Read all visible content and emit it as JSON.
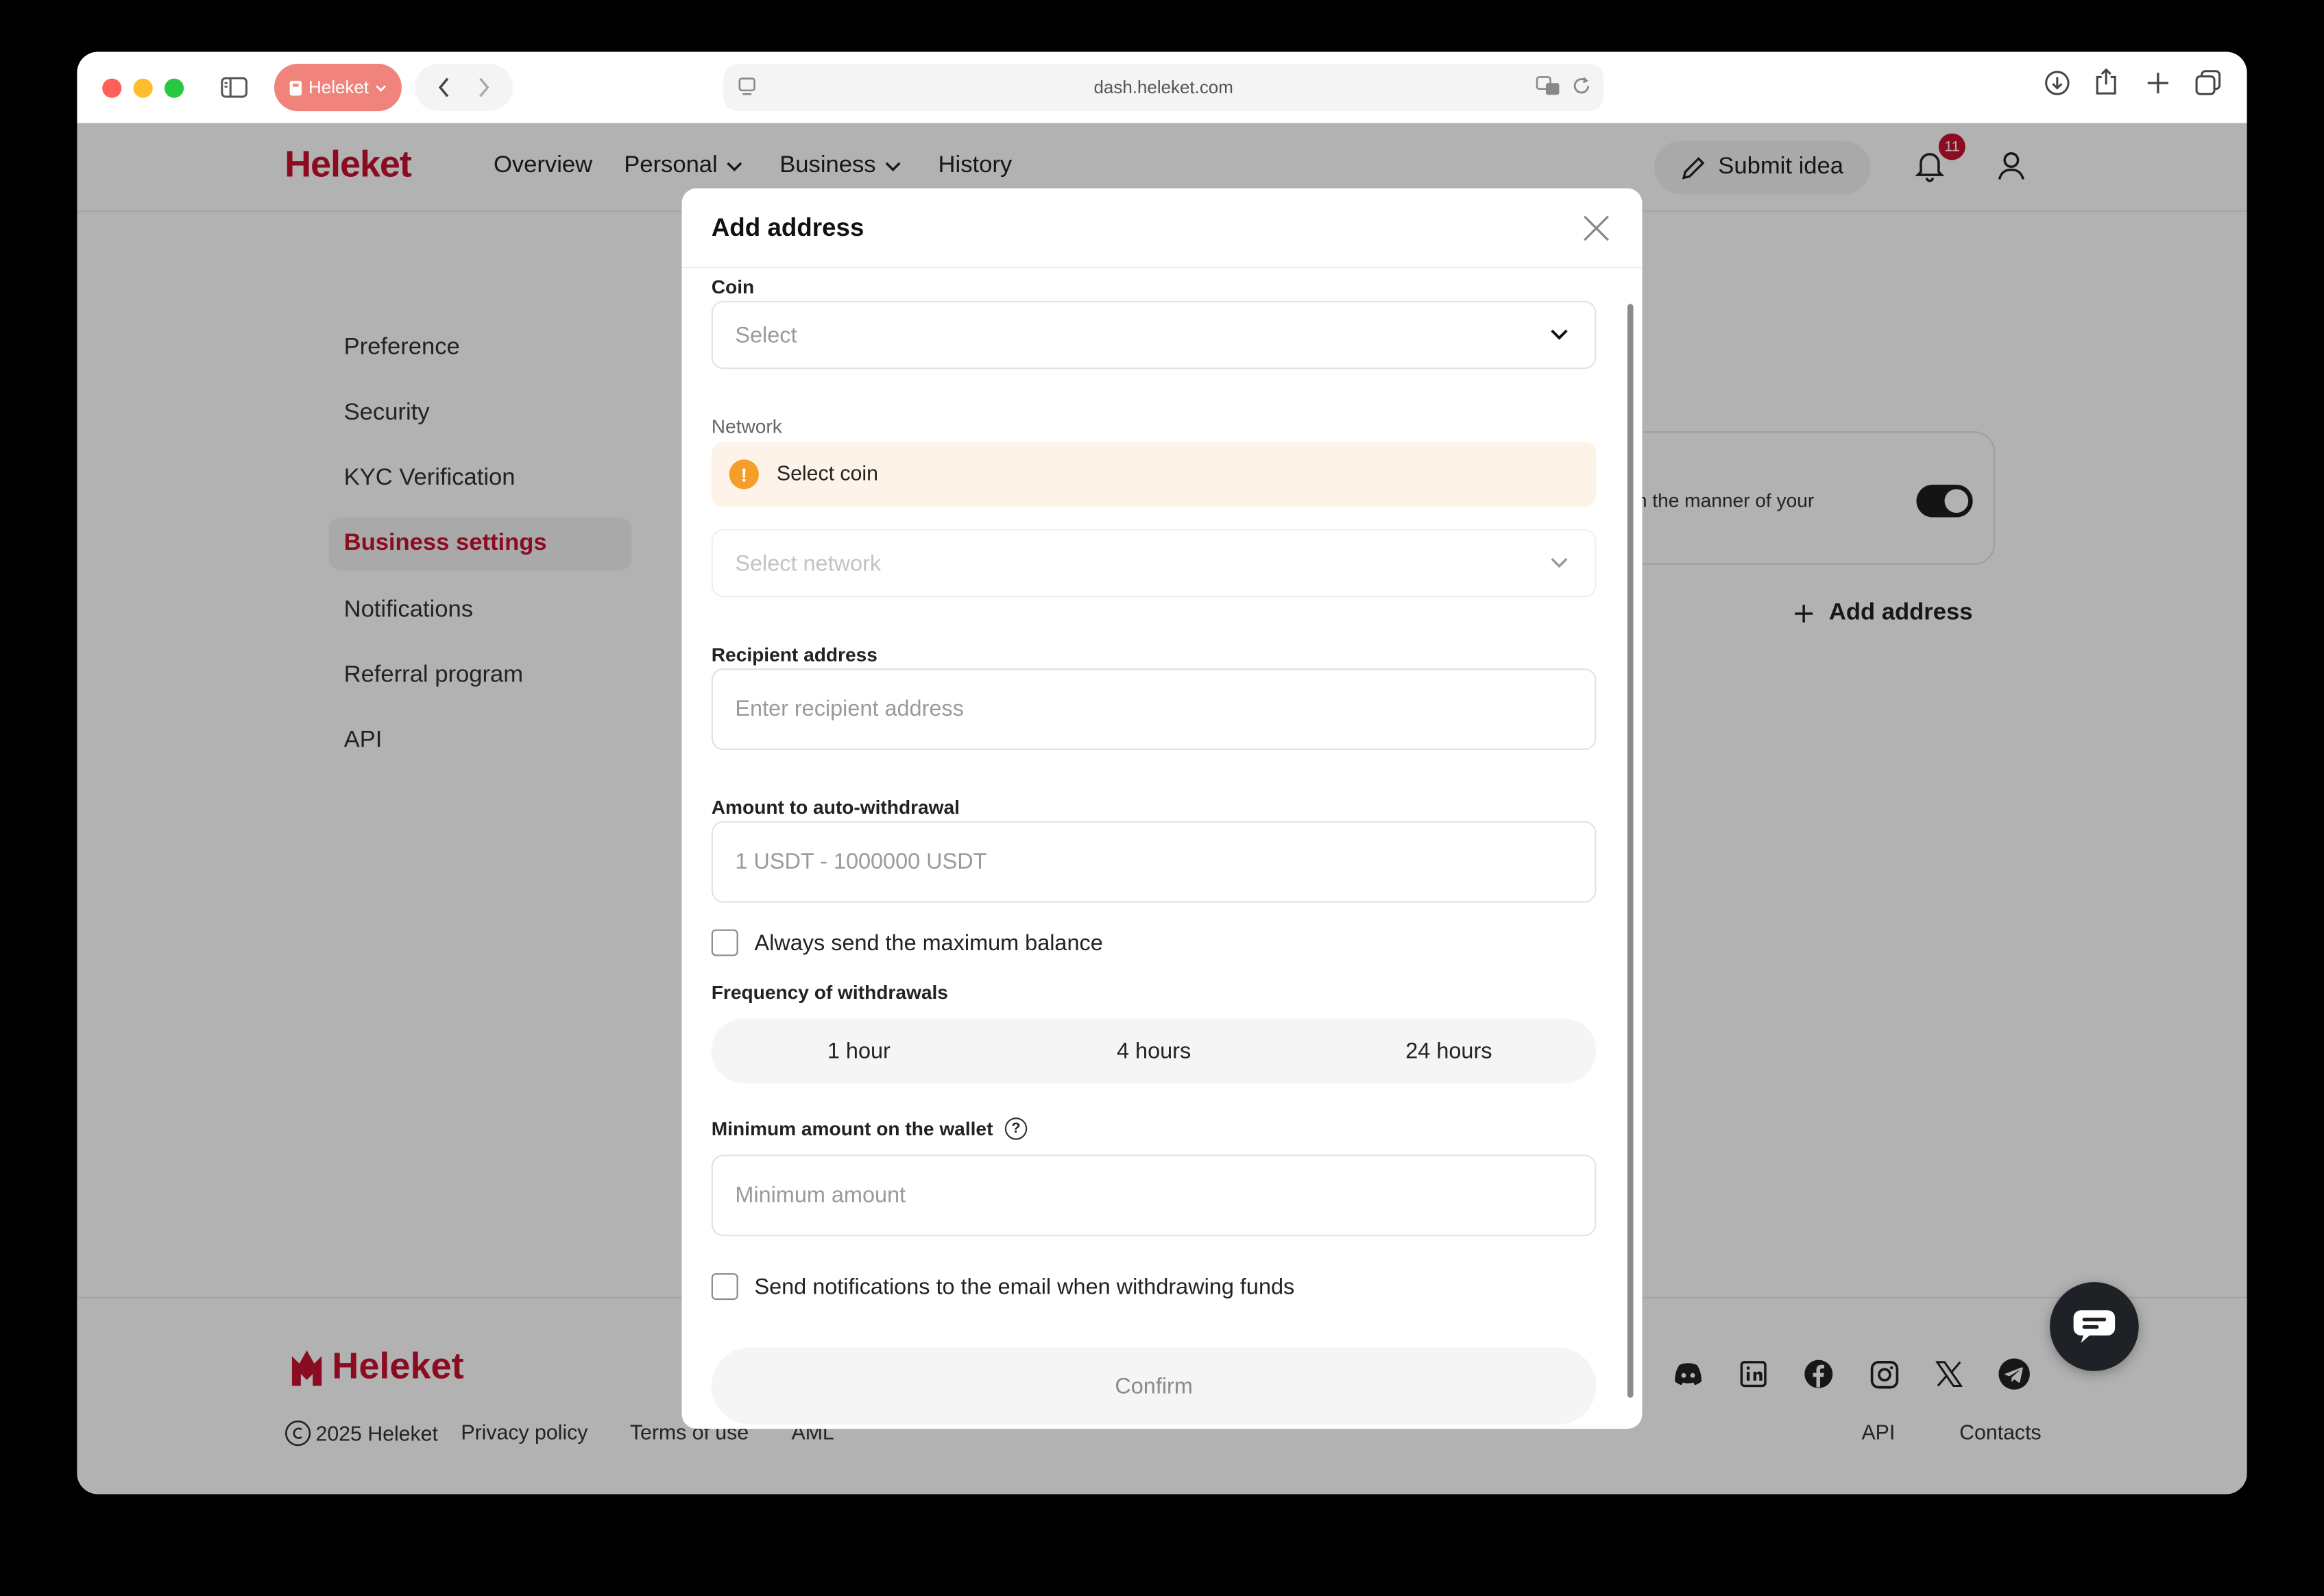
{
  "browser": {
    "tab_group_label": "Heleket",
    "url": "dash.heleket.com"
  },
  "header": {
    "logo": "Heleket",
    "nav": [
      {
        "label": "Overview"
      },
      {
        "label": "Personal"
      },
      {
        "label": "Business"
      },
      {
        "label": "History"
      }
    ],
    "submit_idea": "Submit idea",
    "notification_count": "11"
  },
  "sidebar": {
    "items": [
      {
        "label": "Preference"
      },
      {
        "label": "Security"
      },
      {
        "label": "KYC Verification"
      },
      {
        "label": "Business settings"
      },
      {
        "label": "Notifications"
      },
      {
        "label": "Referral program"
      },
      {
        "label": "API"
      }
    ],
    "active": "Business settings"
  },
  "background": {
    "card_text": "n the manner of your",
    "add_address": "Add address"
  },
  "footer": {
    "logo": "Heleket",
    "copyright": "2025 Heleket",
    "links": [
      {
        "label": "Privacy policy"
      },
      {
        "label": "Terms of use"
      },
      {
        "label": "AML"
      }
    ],
    "right_links": [
      {
        "label": "API"
      },
      {
        "label": "Contacts"
      }
    ]
  },
  "modal": {
    "title": "Add address",
    "coin": {
      "label": "Coin",
      "placeholder": "Select"
    },
    "network": {
      "label": "Network",
      "warning": "Select coin",
      "placeholder": "Select network"
    },
    "recipient": {
      "label": "Recipient address",
      "placeholder": "Enter recipient address"
    },
    "amount": {
      "label": "Amount to auto-withdrawal",
      "placeholder": "1 USDT - 1000000 USDT"
    },
    "always_max": "Always send the maximum balance",
    "frequency": {
      "label": "Frequency of withdrawals",
      "options": [
        "1 hour",
        "4 hours",
        "24 hours"
      ]
    },
    "minimum": {
      "label": "Minimum amount on the wallet",
      "placeholder": "Minimum amount"
    },
    "notify_email": "Send notifications to the email when withdrawing funds",
    "confirm": "Confirm"
  },
  "colors": {
    "brand": "#c8102e",
    "warning": "#f59e2a",
    "warning_bg": "#fdf3e8"
  }
}
